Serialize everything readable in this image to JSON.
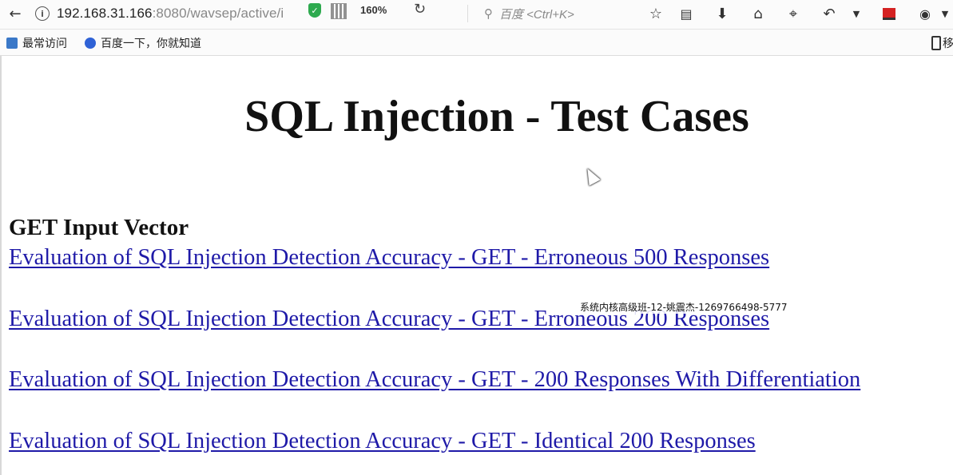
{
  "browser": {
    "url_host": "192.168.31.166",
    "url_rest": ":8080/wavsep/active/i",
    "zoom_level": "160%",
    "search_placeholder": "百度 <Ctrl+K>",
    "icons": {
      "back": "back-arrow-icon",
      "info": "info-icon",
      "shield": "shield-icon",
      "qr": "qr-code-icon",
      "reload": "reload-icon",
      "search": "search-icon",
      "star": "star-icon",
      "reading_list": "reading-list-icon",
      "download": "download-icon",
      "home": "home-icon",
      "crop": "screenshot-crop-icon",
      "undo": "undo-icon",
      "dropdown": "chevron-down-icon",
      "screen": "screen-icon",
      "camera": "camera-icon"
    }
  },
  "bookmarks": {
    "items": [
      {
        "label": "最常访问"
      },
      {
        "label": "百度一下，你就知道"
      }
    ],
    "mobile_label": "移"
  },
  "page": {
    "title": "SQL Injection - Test Cases",
    "section_heading": "GET Input Vector",
    "links": [
      {
        "label": "Evaluation of SQL Injection Detection Accuracy - GET - Erroneous 500 Responses"
      },
      {
        "label": "Evaluation of SQL Injection Detection Accuracy - GET - Erroneous 200 Responses"
      },
      {
        "label": "Evaluation of SQL Injection Detection Accuracy - GET - 200 Responses With Differentiation"
      },
      {
        "label": "Evaluation of SQL Injection Detection Accuracy - GET - Identical 200 Responses"
      }
    ],
    "link_color": "#1f1aa8"
  },
  "overlay": {
    "watermark": "系统内核高级班-12-姚震杰-1269766498-5777"
  }
}
